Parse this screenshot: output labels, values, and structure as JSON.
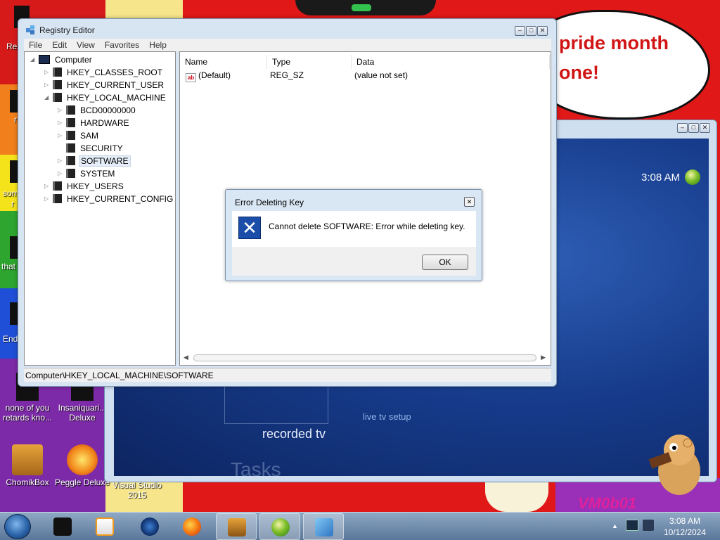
{
  "wallpaper": {
    "speech_line1": "pride month",
    "speech_line2": "one!",
    "tag": "VM0b01"
  },
  "desktop_icons": [
    {
      "label": "none of you retards kno..."
    },
    {
      "label": "Insaniquari... Deluxe"
    },
    {
      "label": "ChomikBox"
    },
    {
      "label": "Peggle Deluxe"
    },
    {
      "label": "Visual Studio 2015"
    }
  ],
  "desktop_edge_labels": [
    "Re",
    "r",
    "som",
    "r",
    "that",
    "End"
  ],
  "media_center": {
    "time": "3:08 AM",
    "recorded_tv": "recorded tv",
    "live_tv_setup": "live tv setup",
    "tasks": "Tasks"
  },
  "regedit": {
    "title": "Registry Editor",
    "menu": [
      "File",
      "Edit",
      "View",
      "Favorites",
      "Help"
    ],
    "tree": {
      "root": "Computer",
      "hives": [
        "HKEY_CLASSES_ROOT",
        "HKEY_CURRENT_USER",
        "HKEY_LOCAL_MACHINE"
      ],
      "hklm_children": [
        "BCD00000000",
        "HARDWARE",
        "SAM",
        "SECURITY",
        "SOFTWARE",
        "SYSTEM"
      ],
      "hives_after": [
        "HKEY_USERS",
        "HKEY_CURRENT_CONFIG"
      ],
      "selected": "SOFTWARE"
    },
    "columns": [
      "Name",
      "Type",
      "Data"
    ],
    "rows": [
      {
        "name": "(Default)",
        "type": "REG_SZ",
        "data": "(value not set)",
        "icon": "ab"
      }
    ],
    "status": "Computer\\HKEY_LOCAL_MACHINE\\SOFTWARE"
  },
  "dialog": {
    "title": "Error Deleting Key",
    "message": "Cannot delete SOFTWARE:  Error while deleting key.",
    "ok_label": "OK",
    "icon": "error-x-icon"
  },
  "taskbar": {
    "items": [
      {
        "name": "desktop-app",
        "active": false
      },
      {
        "name": "media-player",
        "active": false
      },
      {
        "name": "media-center",
        "active": false
      },
      {
        "name": "firefox",
        "active": false
      },
      {
        "name": "chomikbox",
        "active": true
      },
      {
        "name": "windows-orb-app",
        "active": true
      },
      {
        "name": "registry-editor",
        "active": true
      }
    ],
    "time": "3:08 AM",
    "date": "10/12/2024"
  },
  "colors": {
    "accent_blue": "#1b4ea8",
    "window_frame": "#d7e4f2",
    "wallpaper_red": "#e01818",
    "speech_red": "#d11515"
  }
}
